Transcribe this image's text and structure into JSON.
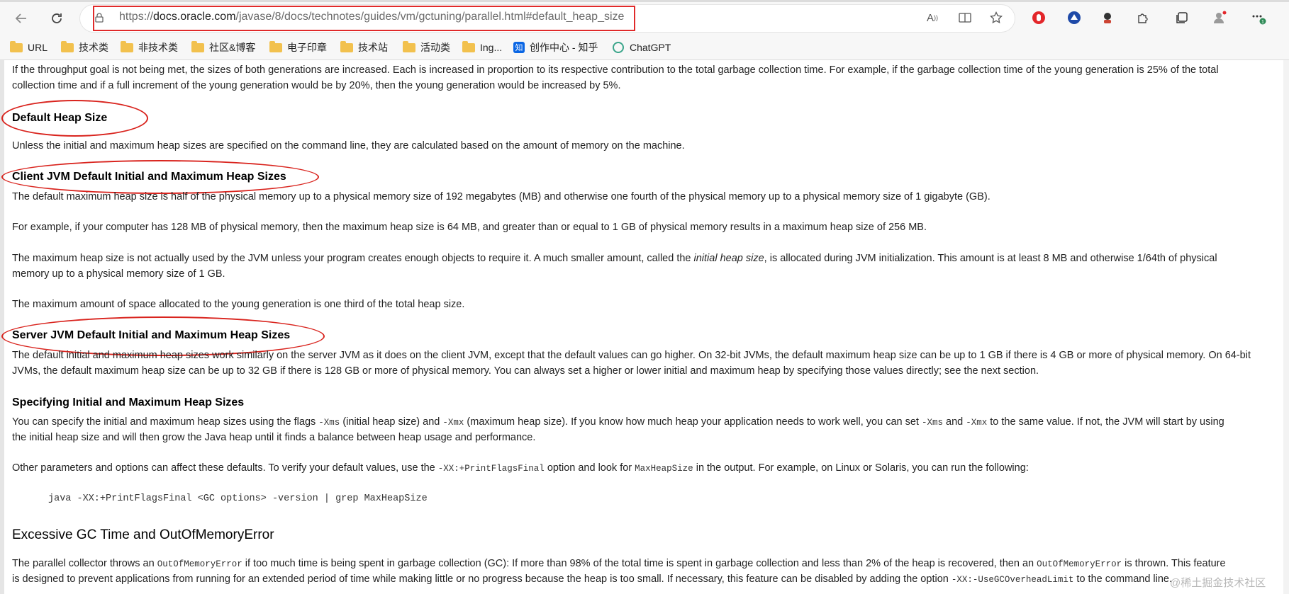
{
  "browser": {
    "url_prefix": "https://",
    "url_domain": "docs.oracle.com",
    "url_path": "/javase/8/docs/technotes/guides/vm/gctuning/parallel.html#default_heap_size",
    "icons": [
      "back-arrow-icon",
      "refresh-icon",
      "lock-icon",
      "read-aloud-icon",
      "immersive-reader-icon",
      "favorite-star-icon",
      "extension-red-icon",
      "extension-blue-icon",
      "extension-avatar-icon",
      "extensions-puzzle-icon",
      "collections-icon",
      "profile-icon",
      "more-menu-icon"
    ]
  },
  "bookmarks": [
    {
      "label": "URL",
      "type": "folder"
    },
    {
      "label": "技术类",
      "type": "folder"
    },
    {
      "label": "非技术类",
      "type": "folder"
    },
    {
      "label": "社区&博客",
      "type": "folder"
    },
    {
      "label": "电子印章",
      "type": "folder"
    },
    {
      "label": "技术站",
      "type": "folder"
    },
    {
      "label": "活动类",
      "type": "folder"
    },
    {
      "label": "Ing...",
      "type": "folder"
    },
    {
      "label": "创作中心 - 知乎",
      "type": "zhihu"
    },
    {
      "label": "ChatGPT",
      "type": "chatgpt"
    }
  ],
  "zhihu_badge": "知",
  "doc": {
    "p_throughput_1": "If the throughput goal is not being met, the sizes of both generations are increased. Each is increased in proportion to its respective contribution to the total garbage collection time. For example, if the garbage collection time of the young generation is 25% of the total",
    "p_throughput_2": "collection time and if a full increment of the young generation would be by 20%, then the young generation would be increased by 5%.",
    "h_default_heap": "Default Heap Size",
    "p_default_heap": "Unless the initial and maximum heap sizes are specified on the command line, they are calculated based on the amount of memory on the machine.",
    "h_client": "Client JVM Default Initial and Maximum Heap Sizes",
    "p_client_1": "The default maximum heap size is half of the physical memory up to a physical memory size of 192 megabytes (MB) and otherwise one fourth of the physical memory up to a physical memory size of 1 gigabyte (GB).",
    "p_client_2": "For example, if your computer has 128 MB of physical memory, then the maximum heap size is 64 MB, and greater than or equal to 1 GB of physical memory results in a maximum heap size of 256 MB.",
    "p_client_3a": "The maximum heap size is not actually used by the JVM unless your program creates enough objects to require it. A much smaller amount, called the ",
    "p_client_3_em": "initial heap size",
    "p_client_3b": ", is allocated during JVM initialization. This amount is at least 8 MB and otherwise 1/64th of physical",
    "p_client_3c": "memory up to a physical memory size of 1 GB.",
    "p_client_4": "The maximum amount of space allocated to the young generation is one third of the total heap size.",
    "h_server": "Server JVM Default Initial and Maximum Heap Sizes",
    "p_server_1": "The default initial and maximum heap sizes work similarly on the server JVM as it does on the client JVM, except that the default values can go higher. On 32-bit JVMs, the default maximum heap size can be up to 1 GB if there is 4 GB or more of physical memory. On 64-bit",
    "p_server_2": "JVMs, the default maximum heap size can be up to 32 GB if there is 128 GB or more of physical memory. You can always set a higher or lower initial and maximum heap by specifying those values directly; see the next section.",
    "h_specifying": "Specifying Initial and Maximum Heap Sizes",
    "p_spec_a": "You can specify the initial and maximum heap sizes using the flags ",
    "code_xms": "-Xms",
    "p_spec_b": " (initial heap size) and ",
    "code_xmx": "-Xmx",
    "p_spec_c": " (maximum heap size). If you know how much heap your application needs to work well, you can set ",
    "p_spec_d": " and ",
    "p_spec_e": " to the same value. If not, the JVM will start by using",
    "p_spec_2": "the initial heap size and will then grow the Java heap until it finds a balance between heap usage and performance.",
    "p_other_a": "Other parameters and options can affect these defaults. To verify your default values, use the ",
    "code_printflags": "-XX:+PrintFlagsFinal",
    "p_other_b": " option and look for ",
    "code_maxheap": "MaxHeapSize",
    "p_other_c": " in the output. For example, on Linux or Solaris, you can run the following:",
    "code_block": "java -XX:+PrintFlagsFinal <GC options> -version | grep MaxHeapSize",
    "h_excessive": "Excessive GC Time and OutOfMemoryError",
    "p_exc_a": "The parallel collector throws an ",
    "code_oom": "OutOfMemoryError",
    "p_exc_b": " if too much time is being spent in garbage collection (GC): If more than 98% of the total time is spent in garbage collection and less than 2% of the heap is recovered, then an ",
    "p_exc_c": " is thrown. This feature",
    "p_exc_2a": "is designed to prevent applications from running for an extended period of time while making little or no progress because the heap is too small. If necessary, this feature can be disabled by adding the option ",
    "code_gcoverhead": "-XX:-UseGCOverheadLimit",
    "p_exc_2b": " to the command line."
  },
  "watermark": "@稀土掘金技术社区",
  "colors": {
    "annotation_red": "#d9241e",
    "folder_yellow": "#f2c14e",
    "zhihu_blue": "#0a66e4"
  }
}
